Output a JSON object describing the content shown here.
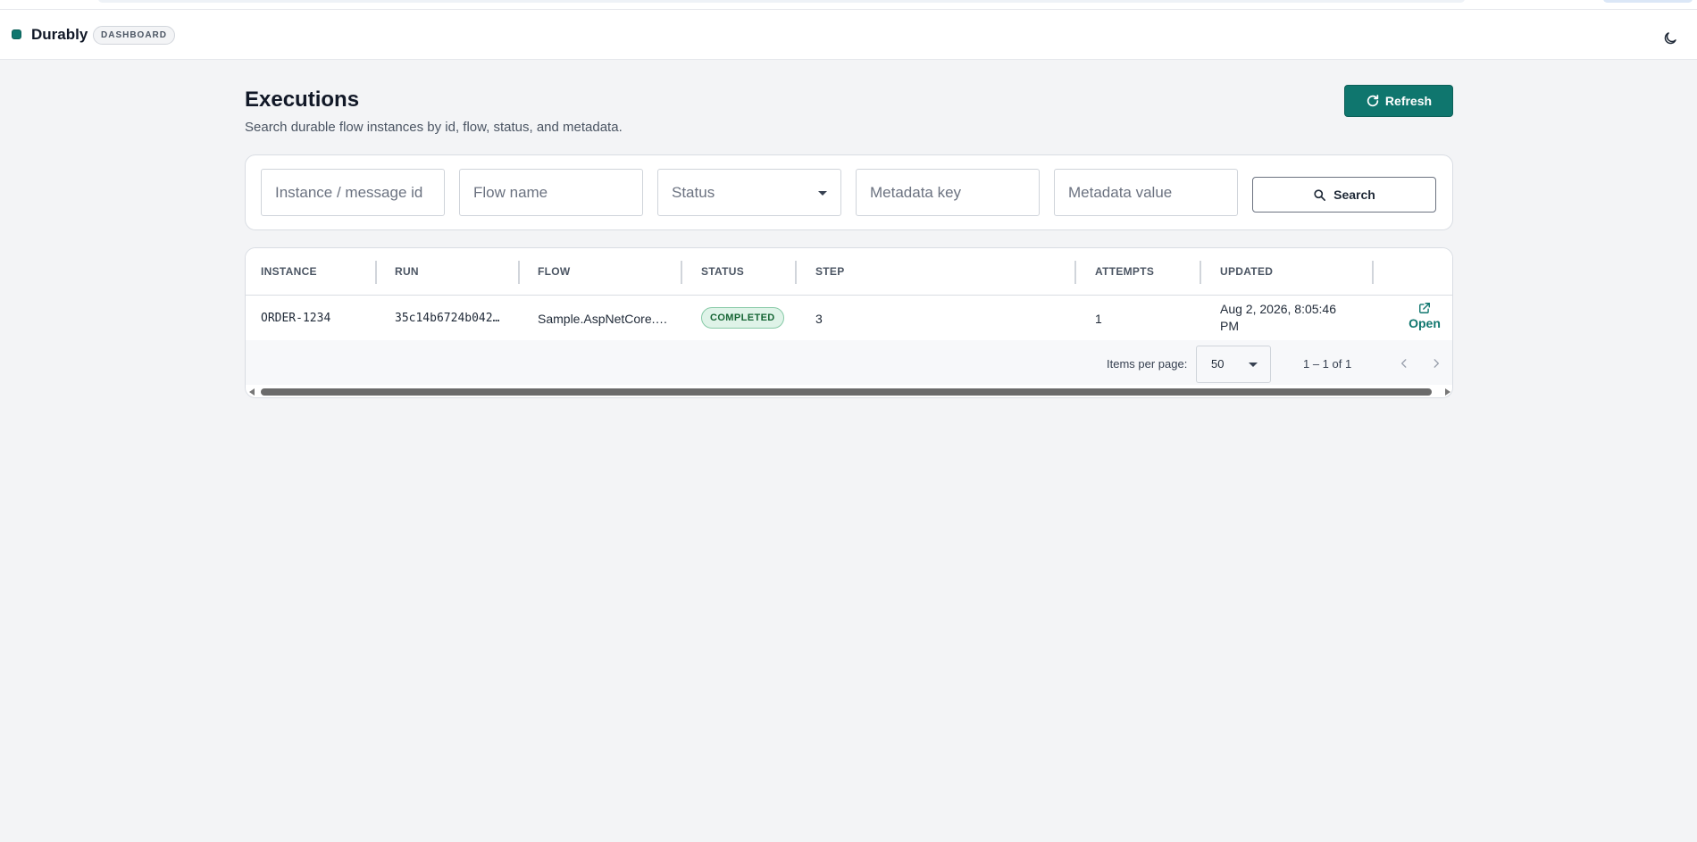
{
  "app": {
    "name": "Durably",
    "badge": "DASHBOARD"
  },
  "icons": {
    "theme_toggle": "moon-icon",
    "refresh": "refresh-icon",
    "search": "search-icon",
    "open": "external-link-icon",
    "prev": "chevron-left-icon",
    "next": "chevron-right-icon"
  },
  "colors": {
    "accent": "#0f766e",
    "status_completed_bg": "#dff3e8",
    "status_completed_text": "#166534"
  },
  "page": {
    "title": "Executions",
    "subtitle": "Search durable flow instances by id, flow, status, and metadata.",
    "refresh_label": "Refresh"
  },
  "search": {
    "instance_placeholder": "Instance / message id",
    "flow_placeholder": "Flow name",
    "status_placeholder": "Status",
    "meta_key_placeholder": "Metadata key",
    "meta_value_placeholder": "Metadata value",
    "button_label": "Search"
  },
  "table": {
    "columns": [
      "INSTANCE",
      "RUN",
      "FLOW",
      "STATUS",
      "STEP",
      "ATTEMPTS",
      "UPDATED"
    ],
    "rows": [
      {
        "instance": "ORDER-1234",
        "run": "35c14b6724b042…",
        "flow": "Sample.AspNetCore.…",
        "status": "COMPLETED",
        "step": "3",
        "attempts": "1",
        "updated_line1": "Aug 2, 2026, 8:05:46",
        "updated_line2": "PM",
        "action": "Open"
      }
    ]
  },
  "paginator": {
    "items_per_page_label": "Items per page:",
    "page_size": "50",
    "range": "1 – 1 of 1"
  }
}
